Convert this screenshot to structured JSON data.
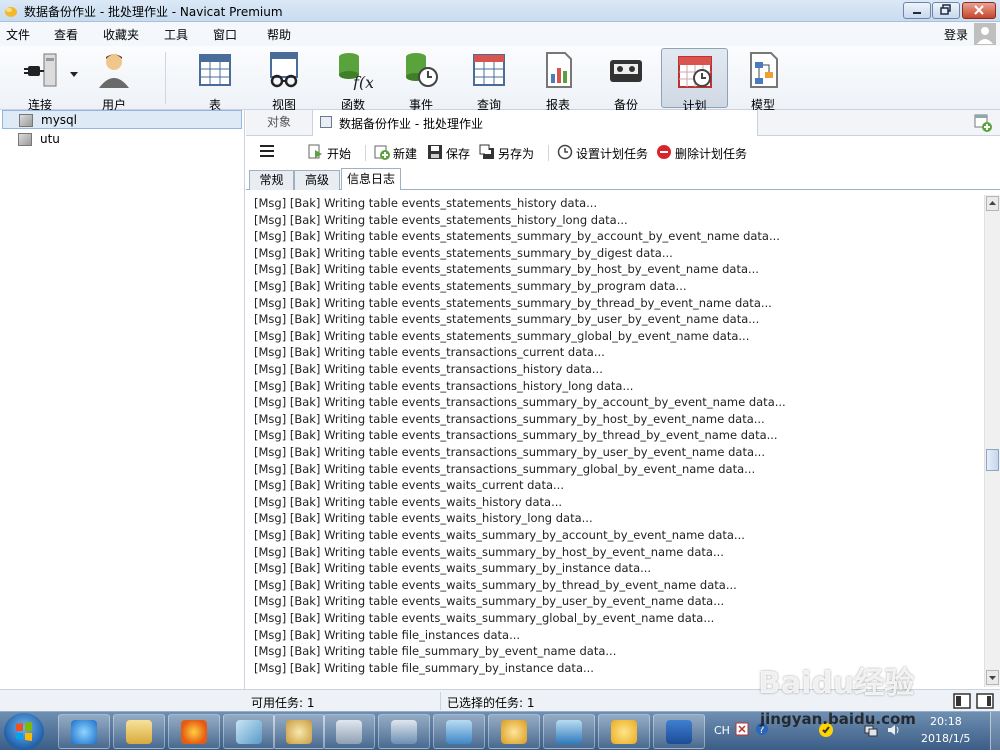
{
  "window": {
    "title": "数据备份作业 - 批处理作业 - Navicat Premium"
  },
  "menu": [
    "文件",
    "查看",
    "收藏夹",
    "工具",
    "窗口",
    "帮助"
  ],
  "login_label": "登录",
  "toolbar": {
    "buttons": [
      "连接",
      "用户",
      "表",
      "视图",
      "函数",
      "事件",
      "查询",
      "报表",
      "备份",
      "计划",
      "模型"
    ],
    "active": "计划"
  },
  "connections": [
    "mysql",
    "utu"
  ],
  "tabs": {
    "object": "对象",
    "document": "数据备份作业 - 批处理作业"
  },
  "actions": {
    "start": "开始",
    "new": "新建",
    "save": "保存",
    "save_as": "另存为",
    "set_schedule": "设置计划任务",
    "delete_schedule": "删除计划任务"
  },
  "subtabs": [
    "常规",
    "高级",
    "信息日志"
  ],
  "active_subtab": "信息日志",
  "log": [
    "[Msg] [Bak] Writing table events_statements_history data...",
    "[Msg] [Bak] Writing table events_statements_history_long data...",
    "[Msg] [Bak] Writing table events_statements_summary_by_account_by_event_name data...",
    "[Msg] [Bak] Writing table events_statements_summary_by_digest data...",
    "[Msg] [Bak] Writing table events_statements_summary_by_host_by_event_name data...",
    "[Msg] [Bak] Writing table events_statements_summary_by_program data...",
    "[Msg] [Bak] Writing table events_statements_summary_by_thread_by_event_name data...",
    "[Msg] [Bak] Writing table events_statements_summary_by_user_by_event_name data...",
    "[Msg] [Bak] Writing table events_statements_summary_global_by_event_name data...",
    "[Msg] [Bak] Writing table events_transactions_current data...",
    "[Msg] [Bak] Writing table events_transactions_history data...",
    "[Msg] [Bak] Writing table events_transactions_history_long data...",
    "[Msg] [Bak] Writing table events_transactions_summary_by_account_by_event_name data...",
    "[Msg] [Bak] Writing table events_transactions_summary_by_host_by_event_name data...",
    "[Msg] [Bak] Writing table events_transactions_summary_by_thread_by_event_name data...",
    "[Msg] [Bak] Writing table events_transactions_summary_by_user_by_event_name data...",
    "[Msg] [Bak] Writing table events_transactions_summary_global_by_event_name data...",
    "[Msg] [Bak] Writing table events_waits_current data...",
    "[Msg] [Bak] Writing table events_waits_history data...",
    "[Msg] [Bak] Writing table events_waits_history_long data...",
    "[Msg] [Bak] Writing table events_waits_summary_by_account_by_event_name data...",
    "[Msg] [Bak] Writing table events_waits_summary_by_host_by_event_name data...",
    "[Msg] [Bak] Writing table events_waits_summary_by_instance data...",
    "[Msg] [Bak] Writing table events_waits_summary_by_thread_by_event_name data...",
    "[Msg] [Bak] Writing table events_waits_summary_by_user_by_event_name data...",
    "[Msg] [Bak] Writing table events_waits_summary_global_by_event_name data...",
    "[Msg] [Bak] Writing table file_instances data...",
    "[Msg] [Bak] Writing table file_summary_by_event_name data...",
    "[Msg] [Bak] Writing table file_summary_by_instance data..."
  ],
  "status": {
    "available_tasks": "可用任务: 1",
    "selected_tasks": "已选择的任务: 1"
  },
  "taskbar": {
    "ime": "CH",
    "time": "20:18",
    "date": "2018/1/5"
  },
  "watermark": {
    "brand": "Baidu经验",
    "url": "jingyan.baidu.com"
  }
}
